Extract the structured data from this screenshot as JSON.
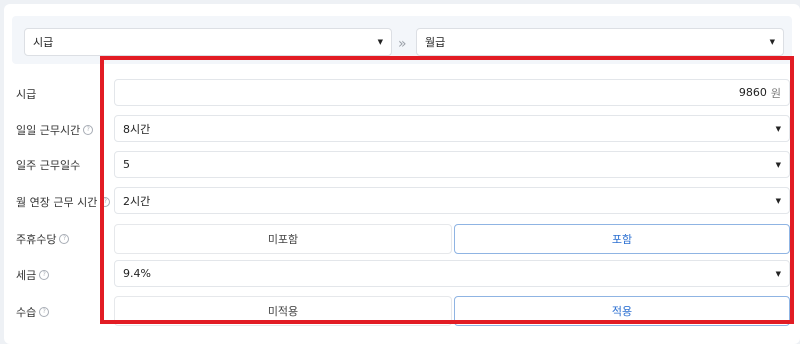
{
  "converter": {
    "from_unit": "시급",
    "to_unit": "월급",
    "arrow_symbol": "»"
  },
  "rows": {
    "hourly_wage": {
      "label": "시급",
      "value": "9860",
      "unit": "원"
    },
    "daily_hours": {
      "label": "일일 근무시간",
      "value": "8시간"
    },
    "weekly_days": {
      "label": "일주 근무일수",
      "value": "5"
    },
    "monthly_overtime": {
      "label": "월 연장 근무 시간",
      "value": "2시간"
    },
    "weekly_holiday_pay": {
      "label": "주휴수당",
      "option_off": "미포함",
      "option_on": "포함",
      "selected": "포함"
    },
    "tax": {
      "label": "세금",
      "value": "9.4%"
    },
    "probation": {
      "label": "수습",
      "option_off": "미적용",
      "option_on": "적용",
      "selected": "적용"
    }
  },
  "icons": {
    "help": "?",
    "caret": "▼"
  },
  "colors": {
    "highlight_border": "#e21c24",
    "selected_text": "#2b6fd1",
    "selected_border": "#8fb4e3"
  }
}
